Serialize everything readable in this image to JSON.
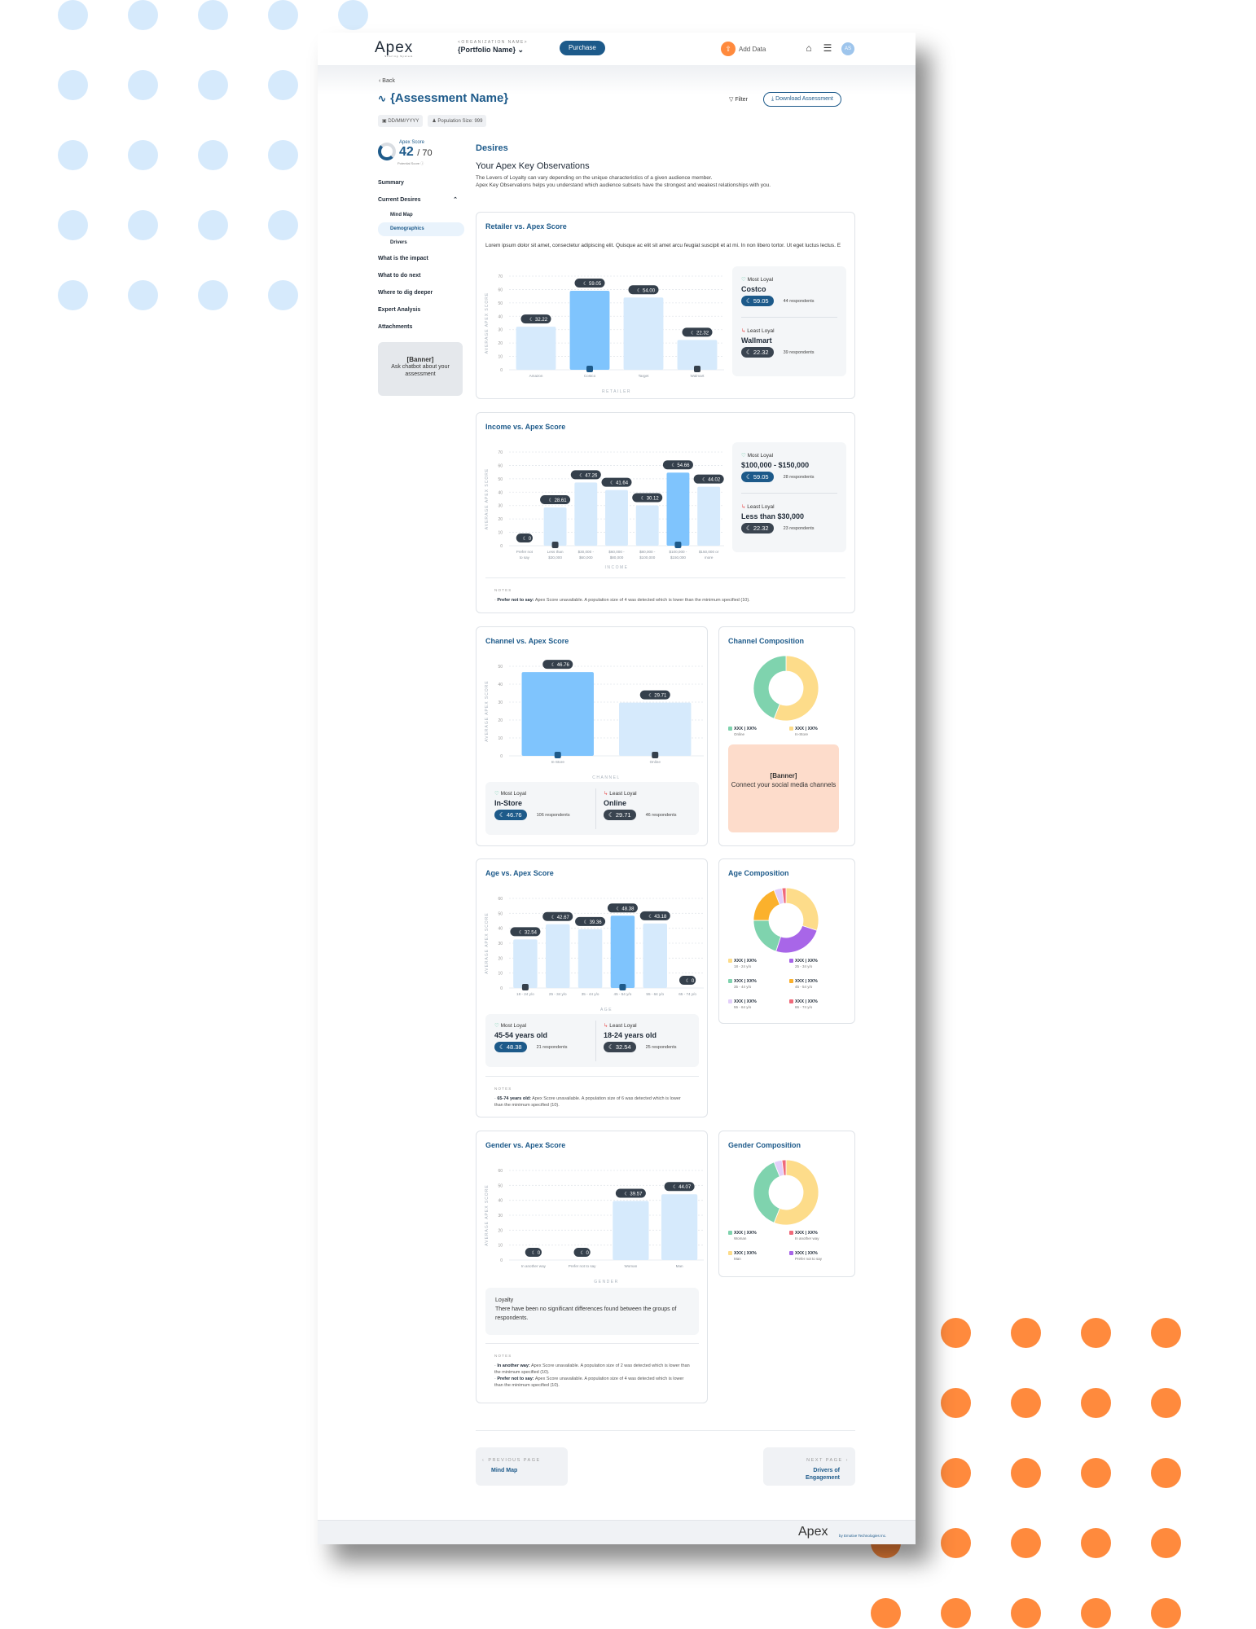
{
  "topbar": {
    "logo": "Apex",
    "logo_sub": "Scoring System",
    "org_label": "<ORGANIZATION NAME>",
    "portfolio": "{Portfolio Name}",
    "purchase": "Purchase",
    "add_data": "Add Data",
    "avatar": "AS"
  },
  "header": {
    "back": "Back",
    "title": "{Assessment Name}",
    "filter": "Filter",
    "download": "Download Assessment",
    "date": "DD/MM/YYYY",
    "population": "Population Size: 999"
  },
  "sidebar": {
    "score_label": "Apex Score",
    "score": "42",
    "score_max": "/ 70",
    "potential": "Potential Score",
    "items": [
      {
        "label": "Summary"
      },
      {
        "label": "Current Desires"
      },
      {
        "label": "Mind Map"
      },
      {
        "label": "Demographics"
      },
      {
        "label": "Drivers"
      },
      {
        "label": "What is the impact"
      },
      {
        "label": "What to do next"
      },
      {
        "label": "Where to dig deeper"
      },
      {
        "label": "Expert Analysis"
      },
      {
        "label": "Attachments"
      }
    ],
    "banner_title": "[Banner]",
    "banner_text": "Ask chatbot about your assessment"
  },
  "main": {
    "section": "Desires",
    "obs_title": "Your Apex Key Observations",
    "obs_desc1": "The Levers of Loyalty can vary depending on the unique characteristics of a given audience member.",
    "obs_desc2": "Apex Key Observations helps you understand which audience subsets have the strongest and weakest relationships with you."
  },
  "labels": {
    "most_loyal": "Most Loyal",
    "least_loyal": "Least Loyal",
    "notes": "NOTES",
    "ylabel": "AVERAGE APEX SCORE"
  },
  "retailer": {
    "title": "Retailer vs. Apex Score",
    "desc": "Lorem ipsum dolor sit amet, consectetur adipiscing elit. Quisque ac elit sit amet arcu feugiat suscipit et at mi. In non libero tortor. Ut eget luctus lectus. E",
    "most_name": "Costco",
    "most_score": "59.05",
    "most_resp": "44 respondents",
    "least_name": "Wallmart",
    "least_score": "22.32",
    "least_resp": "39 respondents"
  },
  "income": {
    "title": "Income vs. Apex Score",
    "most_name": "$100,000 - $150,000",
    "most_score": "59.05",
    "most_resp": "28 respondents",
    "least_name": "Less than $30,000",
    "least_score": "22.32",
    "least_resp": "23 respondents",
    "note_bold": "Prefer not to say:",
    "note_text": " Apex Score unavailable. A population size of 4 was detected which is lower than the minimum specified (10)."
  },
  "channel": {
    "title": "Channel vs. Apex Score",
    "most_name": "In-Store",
    "most_score": "46.76",
    "most_resp": "106 respondents",
    "least_name": "Online",
    "least_score": "29.71",
    "least_resp": "46 respondents"
  },
  "channel_comp": {
    "title": "Channel Composition",
    "legend": [
      {
        "value": "XXX | XX%",
        "label": "Online",
        "color": "#7fd3ae"
      },
      {
        "value": "XXX | XX%",
        "label": "In-Store",
        "color": "#fddc8a"
      }
    ],
    "banner_title": "[Banner]",
    "banner_text": "Connect your social media channels"
  },
  "age": {
    "title": "Age vs. Apex Score",
    "most_name": "45-54 years old",
    "most_score": "48.38",
    "most_resp": "21 respondents",
    "least_name": "18-24 years old",
    "least_score": "32.54",
    "least_resp": "25 respondents",
    "note_bold": "65-74 years old:",
    "note_text": " Apex Score unavailable. A population size of 6 was detected which is lower than the minimum specified (10)."
  },
  "age_comp": {
    "title": "Age Composition",
    "legend": [
      {
        "value": "XXX | XX%",
        "label": "18 - 24 y/o",
        "color": "#fddc8a"
      },
      {
        "value": "XXX | XX%",
        "label": "25 - 34 y/o",
        "color": "#a866e8"
      },
      {
        "value": "XXX | XX%",
        "label": "35 - 44 y/o",
        "color": "#7fd3ae"
      },
      {
        "value": "XXX | XX%",
        "label": "45 - 54 y/o",
        "color": "#fbb12c"
      },
      {
        "value": "XXX | XX%",
        "label": "55 - 64 y/o",
        "color": "#e3cffa"
      },
      {
        "value": "XXX | XX%",
        "label": "65 - 74 y/o",
        "color": "#f06a7a"
      }
    ]
  },
  "gender": {
    "title": "Gender vs. Apex Score",
    "loyalty_title": "Loyalty",
    "loyalty_text": "There have been no significant differences found between the groups of respondents.",
    "note1_bold": "In another way:",
    "note1_text": " Apex Score unavailable. A population size of 2 was detected which is lower than the minimum specified (10).",
    "note2_bold": "Prefer not to say:",
    "note2_text": " Apex Score unavailable. A population size of 4 was detected which is lower than the minimum specified (10)."
  },
  "gender_comp": {
    "title": "Gender Composition",
    "legend": [
      {
        "value": "XXX | XX%",
        "label": "Woman",
        "color": "#7fd3ae"
      },
      {
        "value": "XXX | XX%",
        "label": "In another way",
        "color": "#f06a7a"
      },
      {
        "value": "XXX | XX%",
        "label": "Man",
        "color": "#fddc8a"
      },
      {
        "value": "XXX | XX%",
        "label": "Prefer not to say",
        "color": "#a866e8"
      }
    ]
  },
  "pager": {
    "prev_label": "PREVIOUS PAGE",
    "prev_name": "Mind Map",
    "next_label": "NEXT PAGE",
    "next_name": "Drivers of Engagement"
  },
  "footer": {
    "logo": "Apex",
    "by": "by Emotive Technologies Inc."
  },
  "colors": {
    "primary": "#1d5a8a",
    "bar_light": "#d6eafc",
    "bar_highlight": "#7fc4fd",
    "accent_orange": "#ff8a3d"
  },
  "chart_data": [
    {
      "type": "bar",
      "id": "retailer",
      "title": "Retailer vs. Apex Score",
      "xlabel": "RETAILER",
      "ylabel": "AVERAGE APEX SCORE",
      "categories": [
        "Amazon",
        "Costco",
        "Target",
        "Walmart"
      ],
      "values": [
        32.22,
        59.05,
        54.0,
        22.32
      ],
      "labels": [
        "32.22",
        "59.05",
        "54.00",
        "22.32"
      ],
      "highlight": 1,
      "lowest": 3,
      "ylim": [
        0,
        70
      ],
      "yticks": [
        0,
        10,
        20,
        30,
        40,
        50,
        60,
        70
      ],
      "grid": true
    },
    {
      "type": "bar",
      "id": "income",
      "title": "Income vs. Apex Score",
      "xlabel": "INCOME",
      "ylabel": "AVERAGE APEX SCORE",
      "categories": [
        "Prefer not to say",
        "Less than $30,000",
        "$30,000 - $60,000",
        "$60,000 - $80,000",
        "$80,000 - $100,000",
        "$100,000 - $150,000",
        "$150,000 or more"
      ],
      "values": [
        0,
        28.61,
        47.26,
        41.64,
        30.12,
        54.66,
        44.02
      ],
      "labels": [
        "0",
        "28.61",
        "47.26",
        "41.64",
        "30.12",
        "54.66",
        "44.02"
      ],
      "highlight": 5,
      "lowest": 1,
      "ylim": [
        0,
        70
      ],
      "yticks": [
        0,
        10,
        20,
        30,
        40,
        50,
        60,
        70
      ],
      "grid": true
    },
    {
      "type": "bar",
      "id": "channel",
      "title": "Channel vs. Apex Score",
      "xlabel": "CHANNEL",
      "ylabel": "AVERAGE APEX SCORE",
      "categories": [
        "In-Store",
        "Online"
      ],
      "values": [
        46.76,
        29.71
      ],
      "labels": [
        "46.76",
        "29.71"
      ],
      "highlight": 0,
      "lowest": 1,
      "ylim": [
        0,
        50
      ],
      "yticks": [
        0,
        10,
        20,
        30,
        40,
        50
      ],
      "grid": true
    },
    {
      "type": "bar",
      "id": "age",
      "title": "Age vs. Apex Score",
      "xlabel": "AGE",
      "ylabel": "AVERAGE APEX SCORE",
      "categories": [
        "18 - 24 y/o",
        "25 - 34 y/o",
        "35 - 44 y/o",
        "45 - 54 y/o",
        "55 - 64 y/o",
        "65 - 74 y/o"
      ],
      "values": [
        32.54,
        42.67,
        39.36,
        48.38,
        43.18,
        0
      ],
      "labels": [
        "32.54",
        "42.67",
        "39.36",
        "48.38",
        "43.18",
        "0"
      ],
      "highlight": 3,
      "lowest": 0,
      "ylim": [
        0,
        60
      ],
      "yticks": [
        0,
        10,
        20,
        30,
        40,
        50,
        60
      ],
      "grid": true
    },
    {
      "type": "bar",
      "id": "gender",
      "title": "Gender vs. Apex Score",
      "xlabel": "GENDER",
      "ylabel": "AVERAGE APEX SCORE",
      "categories": [
        "In another way",
        "Prefer not to say",
        "Woman",
        "Man"
      ],
      "values": [
        0,
        0,
        39.57,
        44.07
      ],
      "labels": [
        "0",
        "0",
        "39.57",
        "44.07"
      ],
      "highlight": -1,
      "lowest": -1,
      "ylim": [
        0,
        60
      ],
      "yticks": [
        0,
        10,
        20,
        30,
        40,
        50,
        60
      ],
      "grid": true
    },
    {
      "type": "pie",
      "id": "channel_comp",
      "title": "Channel Composition",
      "categories": [
        "In-Store",
        "Online"
      ],
      "values": [
        56,
        44
      ],
      "colors": [
        "#fddc8a",
        "#7fd3ae"
      ]
    },
    {
      "type": "pie",
      "id": "age_comp",
      "title": "Age Composition",
      "categories": [
        "18 - 24 y/o",
        "25 - 34 y/o",
        "35 - 44 y/o",
        "45 - 54 y/o",
        "55 - 64 y/o",
        "65 - 74 y/o"
      ],
      "values": [
        30,
        25,
        20,
        19,
        4,
        2
      ],
      "colors": [
        "#fddc8a",
        "#a866e8",
        "#7fd3ae",
        "#fbb12c",
        "#e3cffa",
        "#f06a7a"
      ]
    },
    {
      "type": "pie",
      "id": "gender_comp",
      "title": "Gender Composition",
      "categories": [
        "Man",
        "Woman",
        "Prefer not to say",
        "In another way"
      ],
      "values": [
        56,
        38,
        4,
        2
      ],
      "colors": [
        "#fddc8a",
        "#7fd3ae",
        "#e3cffa",
        "#f06a7a"
      ]
    }
  ]
}
